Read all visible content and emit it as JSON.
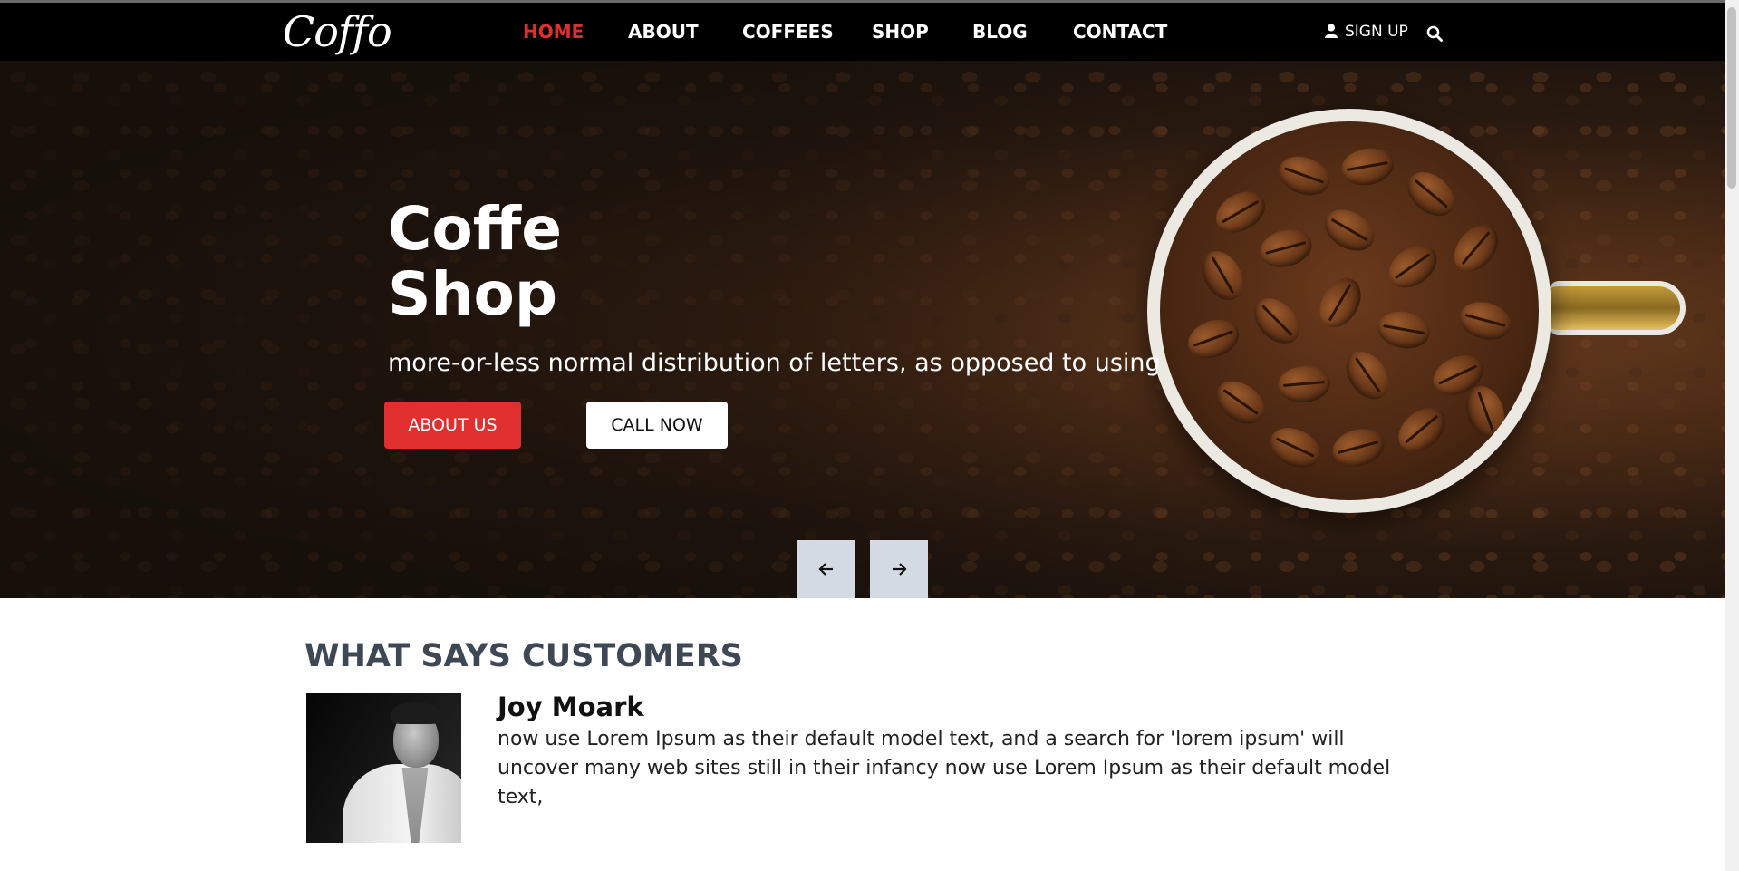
{
  "brand": {
    "logo": "Coffo"
  },
  "nav": {
    "items": [
      {
        "label": "HOME",
        "active": true
      },
      {
        "label": "ABOUT",
        "active": false
      },
      {
        "label": "COFFEES",
        "active": false
      },
      {
        "label": "SHOP",
        "active": false
      },
      {
        "label": "BLOG",
        "active": false
      },
      {
        "label": "CONTACT",
        "active": false
      }
    ],
    "signup_label": "SIGN UP",
    "icons": {
      "user": "user-icon",
      "search": "search-icon"
    }
  },
  "hero": {
    "title": "Coffe\nShop",
    "subtitle": "more-or-less normal distribution of letters, as opposed to using",
    "buttons": {
      "about": "ABOUT US",
      "call": "CALL NOW"
    },
    "arrows": {
      "prev": "arrow-left-icon",
      "next": "arrow-right-icon"
    }
  },
  "testimonials": {
    "heading": "WHAT SAYS CUSTOMERS",
    "items": [
      {
        "name": "Joy Moark",
        "text": "now use Lorem Ipsum as their default model text, and a search for 'lorem ipsum' will uncover many web sites still in their infancy now use Lorem Ipsum as their default model text,"
      }
    ]
  },
  "colors": {
    "accent": "#e02f2f",
    "nav_bg": "#000000",
    "heading": "#3e4754",
    "arrow_bg": "#d3dae3"
  }
}
